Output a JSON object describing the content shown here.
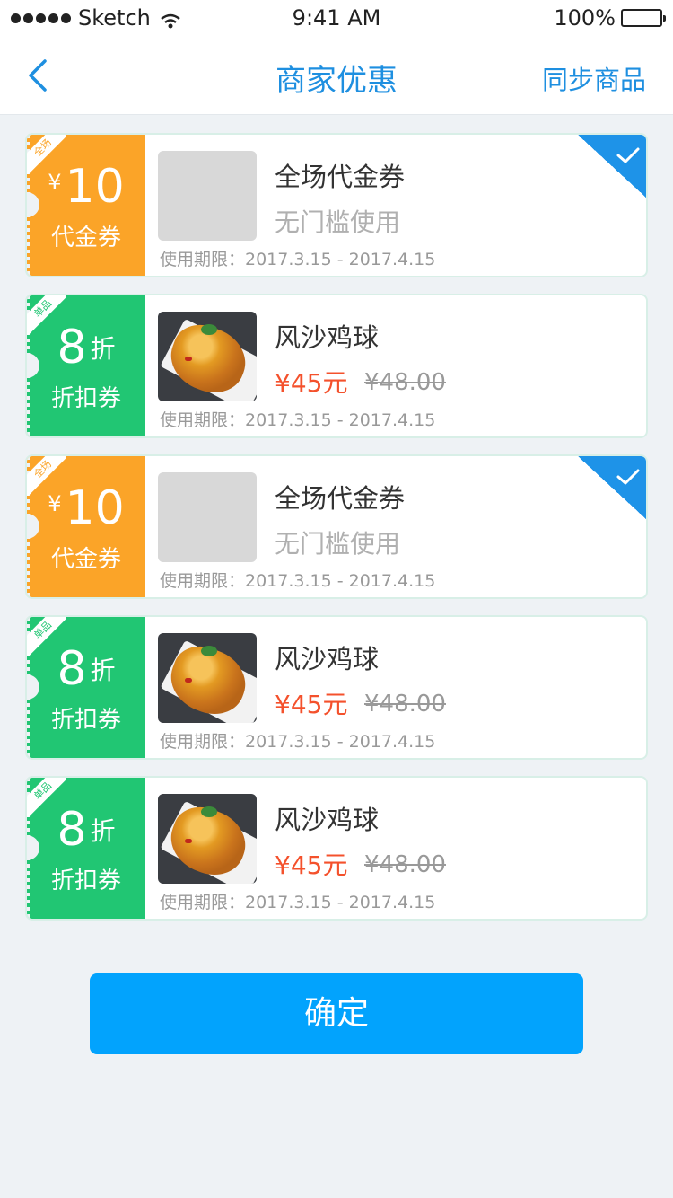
{
  "status_bar": {
    "carrier": "Sketch",
    "time": "9:41 AM",
    "battery": "100%"
  },
  "navbar": {
    "title": "商家优惠",
    "right_action": "同步商品"
  },
  "coupons": [
    {
      "color": "#fba428",
      "tag": "全场",
      "currency": "¥",
      "value": "10",
      "unit": "",
      "type_label": "代金券",
      "name": "全场代金券",
      "desc": "无门槛使用",
      "price": "",
      "old_price": "",
      "period": "使用期限：2017.3.15 - 2017.4.15",
      "selected": true
    },
    {
      "color": "#21c673",
      "tag": "单品",
      "currency": "",
      "value": "8",
      "unit": "折",
      "type_label": "折扣券",
      "name": "风沙鸡球",
      "desc": "",
      "price": "¥45元",
      "old_price": "¥48.00",
      "period": "使用期限：2017.3.15 - 2017.4.15",
      "selected": false
    },
    {
      "color": "#fba428",
      "tag": "全场",
      "currency": "¥",
      "value": "10",
      "unit": "",
      "type_label": "代金券",
      "name": "全场代金券",
      "desc": "无门槛使用",
      "price": "",
      "old_price": "",
      "period": "使用期限：2017.3.15 - 2017.4.15",
      "selected": true
    },
    {
      "color": "#21c673",
      "tag": "单品",
      "currency": "",
      "value": "8",
      "unit": "折",
      "type_label": "折扣券",
      "name": "风沙鸡球",
      "desc": "",
      "price": "¥45元",
      "old_price": "¥48.00",
      "period": "使用期限：2017.3.15 - 2017.4.15",
      "selected": false
    },
    {
      "color": "#21c673",
      "tag": "单品",
      "currency": "",
      "value": "8",
      "unit": "折",
      "type_label": "折扣券",
      "name": "风沙鸡球",
      "desc": "",
      "price": "¥45元",
      "old_price": "¥48.00",
      "period": "使用期限：2017.3.15 - 2017.4.15",
      "selected": false
    }
  ],
  "confirm_label": "确定",
  "colors": {
    "accent": "#1e8fe0",
    "voucher": "#fba428",
    "discount": "#21c673",
    "price": "#f4512c",
    "button": "#02a3fd"
  },
  "icons": [
    "signal-dots-icon",
    "wifi-icon",
    "battery-icon",
    "back-chevron-icon",
    "check-icon"
  ]
}
